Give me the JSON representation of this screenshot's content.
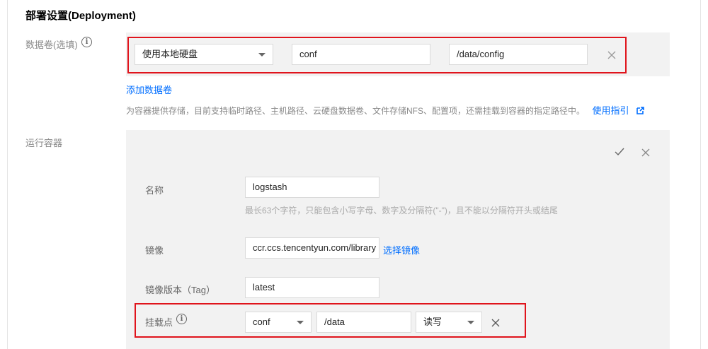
{
  "section": {
    "title": "部署设置(Deployment)"
  },
  "volume": {
    "label": "数据卷(选填)",
    "type_value": "使用本地硬盘",
    "name_value": "conf",
    "path_value": "/data/config",
    "add_link": "添加数据卷",
    "description": "为容器提供存储，目前支持临时路径、主机路径、云硬盘数据卷、文件存储NFS、配置项，还需挂载到容器的指定路径中。",
    "guide_link": "使用指引"
  },
  "container": {
    "label": "运行容器",
    "name_label": "名称",
    "name_value": "logstash",
    "name_hint": "最长63个字符，只能包含小写字母、数字及分隔符(\"-\")，且不能以分隔符开头或结尾",
    "image_label": "镜像",
    "image_value": "ccr.ccs.tencentyun.com/library",
    "image_link": "选择镜像",
    "version_label": "镜像版本（Tag）",
    "version_value": "latest",
    "mount_label": "挂载点",
    "mount_volume": "conf",
    "mount_path": "/data",
    "mount_mode": "读写"
  },
  "icons": {
    "info": "info-icon",
    "close": "close-icon",
    "check": "check-icon",
    "external": "external-link-icon",
    "dropdown": "chevron-down-icon"
  },
  "colors": {
    "link": "#006eff",
    "highlight": "#e0141c",
    "panel": "#f2f2f2"
  }
}
